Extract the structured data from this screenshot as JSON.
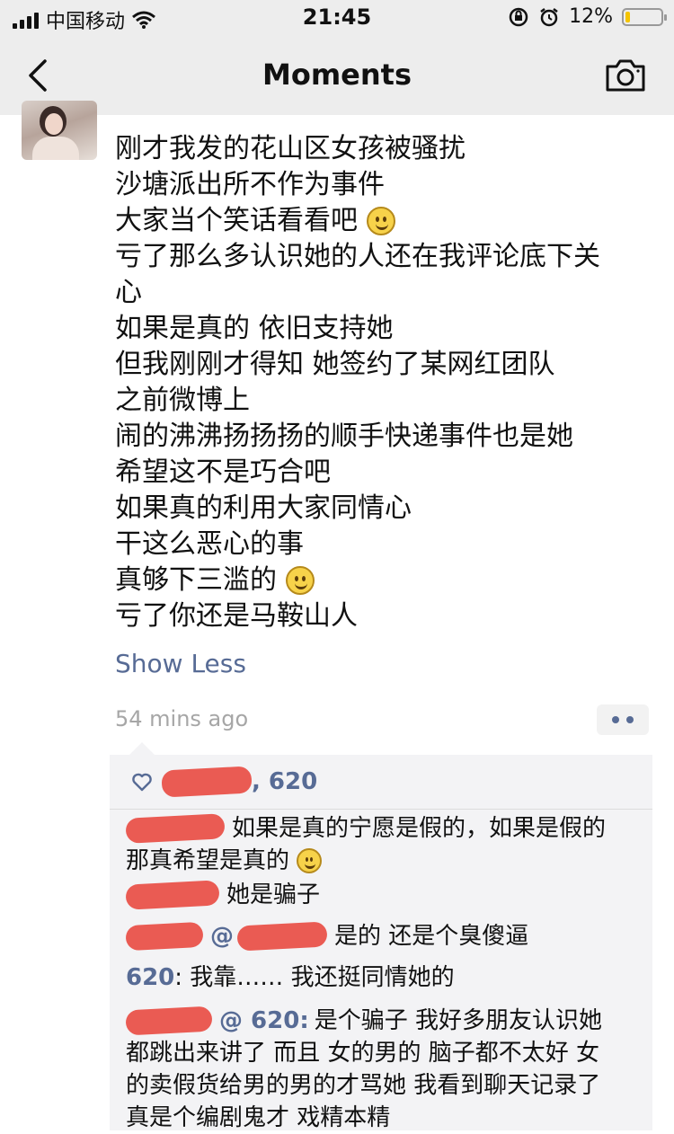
{
  "status_bar": {
    "carrier": "中国移动",
    "time": "21:45",
    "battery": "12%",
    "battery_level": 0.12
  },
  "nav": {
    "title": "Moments",
    "icons": [
      "back-icon",
      "camera-icon"
    ]
  },
  "post": {
    "lines": [
      "刚才我发的花山区女孩被骚扰",
      "沙塘派出所不作为事件",
      "大家当个笑话看看吧",
      "亏了那么多认识她的人还在我评论底下关",
      "心",
      "如果是真的 依旧支持她",
      "但我刚刚才得知 她签约了某网红团队",
      "之前微博上",
      "闹的沸沸扬扬扬的顺手快递事件也是她",
      "希望这不是巧合吧",
      "如果真的利用大家同情心",
      "干这么恶心的事",
      "真够下三滥的",
      "亏了你还是马鞍山人"
    ],
    "show_less": "Show Less",
    "time_ago": "54 mins ago"
  },
  "likes": {
    "text": ", 620"
  },
  "comments": [
    {
      "lines": [
        "如果是真的宁愿是假的，如果是假的",
        "那真希望是真的"
      ]
    },
    {
      "lines": [
        "她是骗子"
      ]
    },
    {
      "lines": [
        "是的 还是个臭傻逼"
      ],
      "prefix": "@"
    },
    {
      "name": "620",
      "lines": [
        ": 我靠…… 我还挺同情她的"
      ]
    },
    {
      "lines": [
        "是个骗子 我好多朋友认识她",
        "都跳出来讲了 而且 女的男的 脑子都不太好 女",
        "的卖假货给男的男的才骂她 我看到聊天记录了",
        "真是个编剧鬼才 戏精本精"
      ],
      "prefix": "@ 620:"
    }
  ],
  "colors": {
    "link": "#576b95",
    "bar_bg": "#ededed",
    "comment_bg": "#f3f3f5",
    "redaction": "#e8453c"
  }
}
